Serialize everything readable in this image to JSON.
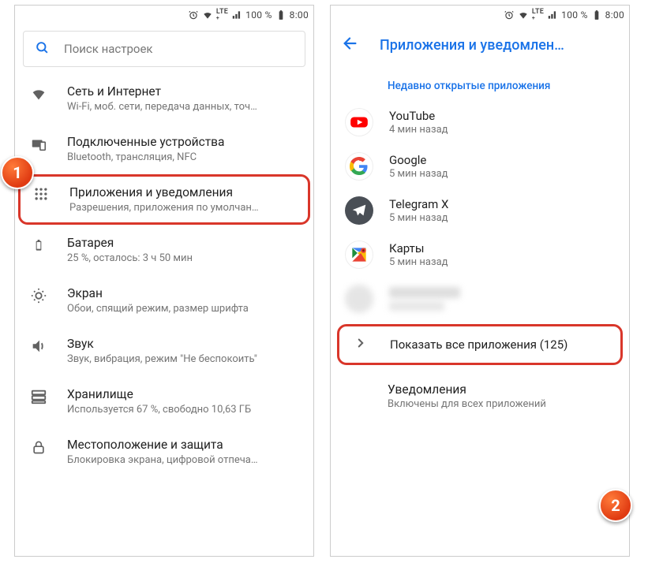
{
  "status": {
    "battery_pct": "100 %",
    "time": "8:00"
  },
  "left": {
    "search_placeholder": "Поиск настроек",
    "items": [
      {
        "title": "Сеть и Интернет",
        "sub": "Wi-Fi, моб. сети, передача данных, точ…"
      },
      {
        "title": "Подключенные устройства",
        "sub": "Bluetooth, трансляция, NFC"
      },
      {
        "title": "Приложения и уведомления",
        "sub": "Разрешения, приложения по умолчан…"
      },
      {
        "title": "Батарея",
        "sub": "25 %, осталось: 3 ч 50 мин"
      },
      {
        "title": "Экран",
        "sub": "Обои, спящий режим, размер шрифта"
      },
      {
        "title": "Звук",
        "sub": "Звук, вибрация, режим \"Не беспокоить\""
      },
      {
        "title": "Хранилище",
        "sub": "Используется 67 %, свободно 10,63 ГБ"
      },
      {
        "title": "Местоположение и защита",
        "sub": "Блокировка экрана, цифровой отпеча…"
      }
    ]
  },
  "right": {
    "appbar_title": "Приложения и уведомлен…",
    "section_header": "Недавно открытые приложения",
    "apps": [
      {
        "name": "YouTube",
        "sub": "4 мин назад"
      },
      {
        "name": "Google",
        "sub": "5 мин назад"
      },
      {
        "name": "Telegram X",
        "sub": "5 мин назад"
      },
      {
        "name": "Карты",
        "sub": "5 мин назад"
      },
      {
        "name": "",
        "sub": ""
      }
    ],
    "show_all": "Показать все приложения (125)",
    "notifications": {
      "title": "Уведомления",
      "sub": "Включены для всех приложений"
    }
  },
  "callouts": {
    "one": "1",
    "two": "2"
  }
}
